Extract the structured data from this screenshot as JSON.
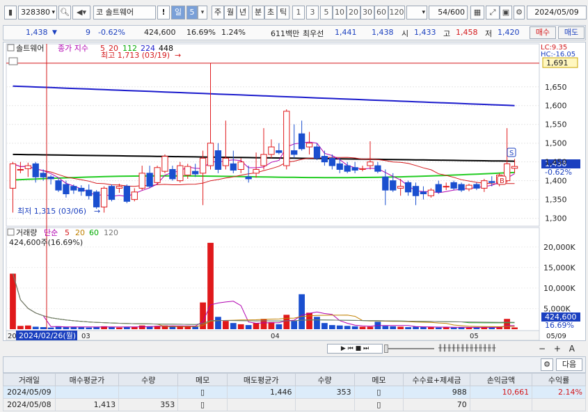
{
  "toolbar": {
    "code": "328380",
    "market": "코",
    "name": "솔트웨어",
    "warn": "!",
    "period_day": "일",
    "period_num": "5",
    "periods": [
      "주",
      "월",
      "년",
      "분",
      "초",
      "틱"
    ],
    "nums": [
      "1",
      "3",
      "5",
      "10",
      "20",
      "30",
      "60",
      "120"
    ],
    "count": "54",
    "count_total": "/600",
    "date": "2024/05/09"
  },
  "quote": {
    "price": "1,438",
    "arrow": "▼",
    "change": "9",
    "change_rate": "-0.62%",
    "volume": "424,600",
    "turnover": "16.69%",
    "ratio": "1.24%",
    "amount": "611백만",
    "best_label": "최우선",
    "best_ask": "1,441",
    "best_bid": "1,438",
    "open_label": "시",
    "open": "1,433",
    "high_label": "고",
    "high": "1,458",
    "low_label": "저",
    "low": "1,420",
    "buy_label": "매수",
    "sell_label": "매도"
  },
  "price_pane": {
    "title": "솔트웨어",
    "ma_label": "종가 지수",
    "ma_periods": [
      "5",
      "20",
      "112",
      "224",
      "448"
    ],
    "ma_colors": [
      "#d4181b",
      "#d4181b",
      "#00aa00",
      "#1a1acc",
      "#000000"
    ],
    "high_note": "최고 1,713 (03/19)",
    "low_note": "최저 1,315 (03/06)",
    "lc": "LC:9.35",
    "hc": "HC:-16.05",
    "high_price_tag": "1,691",
    "last_tag": "1,438",
    "last_rate_tag": "-0.62%",
    "sell_marker": "S",
    "buy_marker": "B",
    "y_ticks": [
      "1,650",
      "1,600",
      "1,550",
      "1,500",
      "1,450",
      "1,400",
      "1,350",
      "1,300"
    ]
  },
  "volume_pane": {
    "title": "거래량",
    "ma_label": "단순",
    "ma_periods": [
      "5",
      "20",
      "60",
      "120"
    ],
    "ma_colors": [
      "#d4181b",
      "#c08000",
      "#00aa00",
      "#777777"
    ],
    "current": "424,600주(16.69%)",
    "y_ticks": [
      "20,000K",
      "15,000K",
      "10,000K",
      "5,000K"
    ],
    "last_tag": "424,600",
    "last_rate_tag": "16.69%"
  },
  "x_axis": {
    "labels": [
      "20",
      "03",
      "04",
      "05",
      "05/09"
    ],
    "cursor_date": "2024/02/26(월)"
  },
  "grid": {
    "next_label": "다음",
    "headers": [
      "거래일",
      "매수평균가",
      "수량",
      "메모",
      "매도평균가",
      "수량",
      "메모",
      "수수료+제세금",
      "손익금액",
      "수익률"
    ],
    "rows": [
      [
        "2024/05/09",
        "",
        "",
        "",
        "1,446",
        "353",
        "",
        "988",
        "10,661",
        "2.14%"
      ],
      [
        "2024/05/08",
        "1,413",
        "353",
        "",
        "",
        "",
        "",
        "70",
        "",
        ""
      ]
    ]
  },
  "chart_data": {
    "type": "candlestick",
    "title": "",
    "price_range": [
      1290,
      1720
    ],
    "volume_range": [
      0,
      22000
    ],
    "candles": [
      {
        "o": 1380,
        "h": 1450,
        "l": 1315,
        "c": 1445
      },
      {
        "o": 1430,
        "h": 1450,
        "l": 1420,
        "c": 1430
      },
      {
        "o": 1432,
        "h": 1448,
        "l": 1410,
        "c": 1440
      },
      {
        "o": 1445,
        "h": 1450,
        "l": 1395,
        "c": 1410
      },
      {
        "o": 1420,
        "h": 1430,
        "l": 1400,
        "c": 1410
      },
      {
        "o": 1410,
        "h": 1415,
        "l": 1390,
        "c": 1405
      },
      {
        "o": 1400,
        "h": 1405,
        "l": 1370,
        "c": 1375
      },
      {
        "o": 1390,
        "h": 1400,
        "l": 1355,
        "c": 1365
      },
      {
        "o": 1385,
        "h": 1390,
        "l": 1365,
        "c": 1375
      },
      {
        "o": 1380,
        "h": 1388,
        "l": 1360,
        "c": 1372
      },
      {
        "o": 1375,
        "h": 1390,
        "l": 1350,
        "c": 1360
      },
      {
        "o": 1370,
        "h": 1375,
        "l": 1325,
        "c": 1330
      },
      {
        "o": 1330,
        "h": 1385,
        "l": 1315,
        "c": 1380
      },
      {
        "o": 1385,
        "h": 1390,
        "l": 1345,
        "c": 1350
      },
      {
        "o": 1380,
        "h": 1392,
        "l": 1368,
        "c": 1385
      },
      {
        "o": 1385,
        "h": 1390,
        "l": 1340,
        "c": 1345
      },
      {
        "o": 1350,
        "h": 1380,
        "l": 1345,
        "c": 1370
      },
      {
        "o": 1380,
        "h": 1440,
        "l": 1375,
        "c": 1420
      },
      {
        "o": 1420,
        "h": 1440,
        "l": 1380,
        "c": 1385
      },
      {
        "o": 1395,
        "h": 1440,
        "l": 1390,
        "c": 1435
      },
      {
        "o": 1425,
        "h": 1470,
        "l": 1420,
        "c": 1465
      },
      {
        "o": 1430,
        "h": 1440,
        "l": 1400,
        "c": 1405
      },
      {
        "o": 1400,
        "h": 1450,
        "l": 1395,
        "c": 1440
      },
      {
        "o": 1415,
        "h": 1445,
        "l": 1405,
        "c": 1438
      },
      {
        "o": 1425,
        "h": 1445,
        "l": 1410,
        "c": 1418
      },
      {
        "o": 1420,
        "h": 1480,
        "l": 1335,
        "c": 1460
      },
      {
        "o": 1440,
        "h": 1713,
        "l": 1430,
        "c": 1500
      },
      {
        "o": 1480,
        "h": 1500,
        "l": 1420,
        "c": 1430
      },
      {
        "o": 1440,
        "h": 1560,
        "l": 1430,
        "c": 1460
      },
      {
        "o": 1445,
        "h": 1480,
        "l": 1420,
        "c": 1428
      },
      {
        "o": 1430,
        "h": 1460,
        "l": 1420,
        "c": 1450
      },
      {
        "o": 1410,
        "h": 1440,
        "l": 1395,
        "c": 1405
      },
      {
        "o": 1420,
        "h": 1475,
        "l": 1408,
        "c": 1430
      },
      {
        "o": 1440,
        "h": 1540,
        "l": 1430,
        "c": 1470
      },
      {
        "o": 1470,
        "h": 1510,
        "l": 1460,
        "c": 1490
      },
      {
        "o": 1480,
        "h": 1500,
        "l": 1470,
        "c": 1475
      },
      {
        "o": 1440,
        "h": 1590,
        "l": 1430,
        "c": 1585
      },
      {
        "o": 1480,
        "h": 1550,
        "l": 1460,
        "c": 1470
      },
      {
        "o": 1525,
        "h": 1560,
        "l": 1480,
        "c": 1485
      },
      {
        "o": 1490,
        "h": 1530,
        "l": 1470,
        "c": 1500
      },
      {
        "o": 1490,
        "h": 1500,
        "l": 1455,
        "c": 1460
      },
      {
        "o": 1465,
        "h": 1480,
        "l": 1440,
        "c": 1450
      },
      {
        "o": 1460,
        "h": 1470,
        "l": 1430,
        "c": 1440
      },
      {
        "o": 1445,
        "h": 1460,
        "l": 1420,
        "c": 1430
      },
      {
        "o": 1440,
        "h": 1450,
        "l": 1420,
        "c": 1425
      },
      {
        "o": 1435,
        "h": 1450,
        "l": 1420,
        "c": 1428
      },
      {
        "o": 1430,
        "h": 1440,
        "l": 1425,
        "c": 1432
      },
      {
        "o": 1440,
        "h": 1505,
        "l": 1430,
        "c": 1450
      },
      {
        "o": 1440,
        "h": 1450,
        "l": 1420,
        "c": 1425
      },
      {
        "o": 1410,
        "h": 1430,
        "l": 1335,
        "c": 1375
      },
      {
        "o": 1400,
        "h": 1420,
        "l": 1370,
        "c": 1375
      },
      {
        "o": 1380,
        "h": 1405,
        "l": 1360,
        "c": 1385
      },
      {
        "o": 1395,
        "h": 1400,
        "l": 1360,
        "c": 1370
      },
      {
        "o": 1385,
        "h": 1395,
        "l": 1335,
        "c": 1360
      },
      {
        "o": 1370,
        "h": 1385,
        "l": 1350,
        "c": 1365
      },
      {
        "o": 1360,
        "h": 1380,
        "l": 1355,
        "c": 1375
      },
      {
        "o": 1390,
        "h": 1400,
        "l": 1365,
        "c": 1370
      },
      {
        "o": 1385,
        "h": 1395,
        "l": 1375,
        "c": 1385
      },
      {
        "o": 1395,
        "h": 1400,
        "l": 1375,
        "c": 1380
      },
      {
        "o": 1390,
        "h": 1395,
        "l": 1370,
        "c": 1375
      },
      {
        "o": 1378,
        "h": 1392,
        "l": 1372,
        "c": 1388
      },
      {
        "o": 1390,
        "h": 1395,
        "l": 1375,
        "c": 1380
      },
      {
        "o": 1380,
        "h": 1405,
        "l": 1370,
        "c": 1400
      },
      {
        "o": 1398,
        "h": 1412,
        "l": 1385,
        "c": 1395
      },
      {
        "o": 1395,
        "h": 1420,
        "l": 1385,
        "c": 1415
      },
      {
        "o": 1400,
        "h": 1540,
        "l": 1395,
        "c": 1445
      },
      {
        "o": 1433,
        "h": 1458,
        "l": 1420,
        "c": 1438
      }
    ],
    "volume": [
      13500,
      800,
      900,
      600,
      500,
      400,
      700,
      500,
      600,
      500,
      400,
      600,
      700,
      500,
      400,
      600,
      500,
      900,
      700,
      800,
      900,
      700,
      800,
      700,
      600,
      6500,
      21000,
      3000,
      2000,
      1500,
      1200,
      1000,
      1500,
      2500,
      1700,
      1200,
      3500,
      2000,
      8500,
      4000,
      3000,
      1500,
      1000,
      900,
      800,
      700,
      600,
      600,
      1800,
      800,
      700,
      600,
      500,
      600,
      500,
      500,
      400,
      500,
      400,
      500,
      400,
      400,
      500,
      400,
      500,
      2500,
      424.6
    ]
  }
}
